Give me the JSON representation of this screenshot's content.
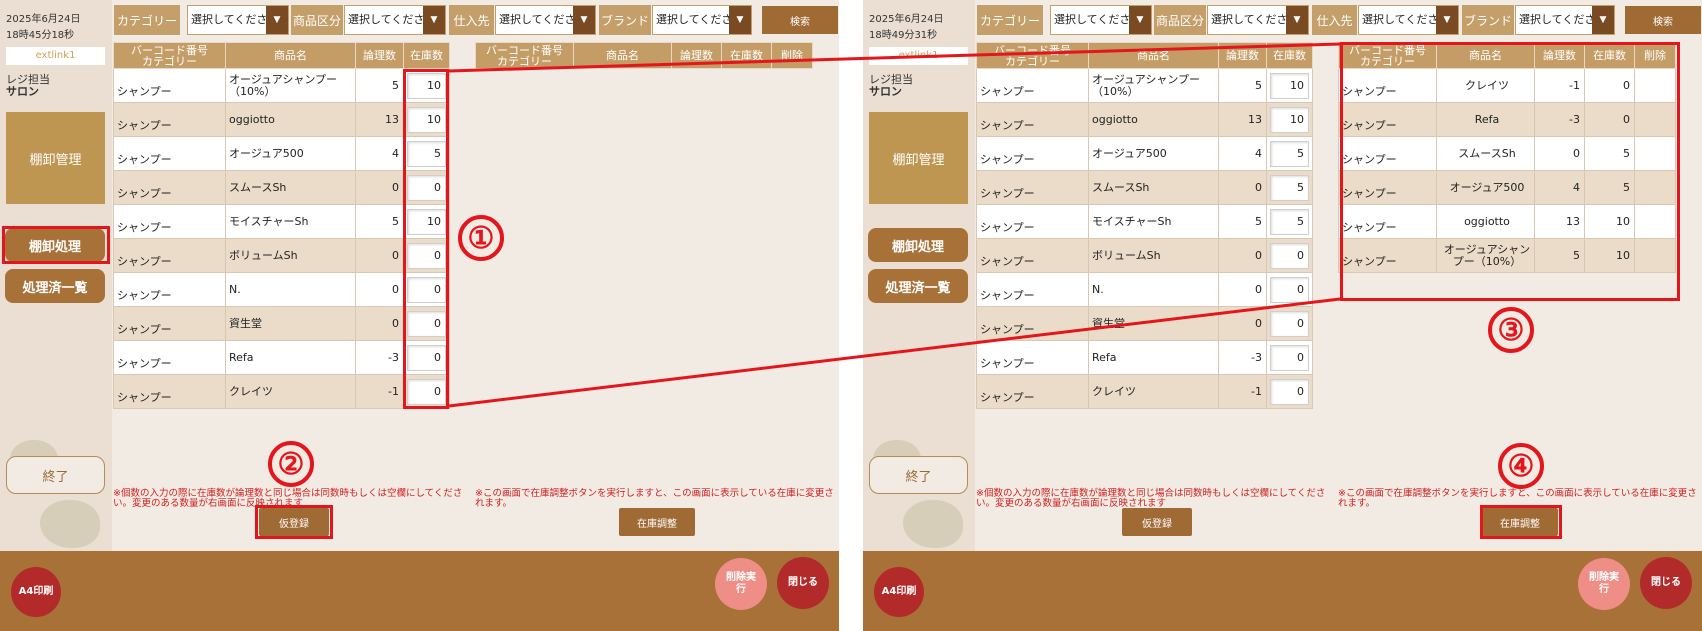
{
  "left": {
    "datetime": {
      "date": "2025年6月24日",
      "time": "18時45分18秒"
    },
    "link": "extlink1",
    "staff_label": "レジ担当",
    "staff_name": "サロン"
  },
  "right": {
    "datetime": {
      "date": "2025年6月24日",
      "time": "18時49分31秒"
    },
    "link": "extlink1",
    "staff_label": "レジ担当",
    "staff_name": "サロン"
  },
  "sidebar": {
    "section_title": "棚卸管理",
    "process_button": "棚卸処理",
    "done_list_button": "処理済一覧",
    "end_button": "終了"
  },
  "filters": {
    "category_label": "カテゴリー",
    "type_label": "商品区分",
    "supplier_label": "仕入先",
    "brand_label": "ブランド",
    "select_placeholder": "選択してください",
    "select_placeholder_short": "選択してくださ",
    "search_button": "検索"
  },
  "main_table": {
    "headers": {
      "barcode_line1": "バーコード番号",
      "barcode_line2": "カテゴリー",
      "name": "商品名",
      "theoretical": "論理数",
      "stock": "在庫数"
    },
    "rows": [
      {
        "category": "シャンプー",
        "name": "オージュアシャンプー（10%）",
        "theoretical": "5",
        "stock_left": "10",
        "stock_right": "10"
      },
      {
        "category": "シャンプー",
        "name": "oggiotto",
        "theoretical": "13",
        "stock_left": "10",
        "stock_right": "10"
      },
      {
        "category": "シャンプー",
        "name": "オージュア500",
        "theoretical": "4",
        "stock_left": "5",
        "stock_right": "5"
      },
      {
        "category": "シャンプー",
        "name": "スムースSh",
        "theoretical": "0",
        "stock_left": "0",
        "stock_right": "5"
      },
      {
        "category": "シャンプー",
        "name": "モイスチャーSh",
        "theoretical": "5",
        "stock_left": "10",
        "stock_right": "5"
      },
      {
        "category": "シャンプー",
        "name": "ボリュームSh",
        "theoretical": "0",
        "stock_left": "0",
        "stock_right": "0"
      },
      {
        "category": "シャンプー",
        "name": "N.",
        "theoretical": "0",
        "stock_left": "0",
        "stock_right": "0"
      },
      {
        "category": "シャンプー",
        "name": "資生堂",
        "theoretical": "0",
        "stock_left": "0",
        "stock_right": "0"
      },
      {
        "category": "シャンプー",
        "name": "Refa",
        "theoretical": "-3",
        "stock_left": "0",
        "stock_right": "0"
      },
      {
        "category": "シャンプー",
        "name": "クレイツ",
        "theoretical": "-1",
        "stock_left": "0",
        "stock_right": "0"
      }
    ]
  },
  "adjust_table": {
    "headers": {
      "barcode_line1": "バーコード番号",
      "barcode_line2": "カテゴリー",
      "name": "商品名",
      "theoretical": "論理数",
      "stock": "在庫数",
      "delete": "削除"
    },
    "rows": [
      {
        "category": "シャンプー",
        "name": "クレイツ",
        "theoretical": "-1",
        "stock": "0"
      },
      {
        "category": "シャンプー",
        "name": "Refa",
        "theoretical": "-3",
        "stock": "0"
      },
      {
        "category": "シャンプー",
        "name": "スムースSh",
        "theoretical": "0",
        "stock": "5"
      },
      {
        "category": "シャンプー",
        "name": "オージュア500",
        "theoretical": "4",
        "stock": "5"
      },
      {
        "category": "シャンプー",
        "name": "oggiotto",
        "theoretical": "13",
        "stock": "10"
      },
      {
        "category": "シャンプー",
        "name": "オージュアシャンプー（10%）",
        "theoretical": "5",
        "stock": "10"
      }
    ]
  },
  "notes": {
    "left": "※個数の入力の際に在庫数が論理数と同じ場合は同数時もしくは空欄にしてください。変更のある数量が右画面に反映されます",
    "right": "※この画面で在庫調整ボタンを実行しますと、この画面に表示している在庫に変更されます。"
  },
  "buttons": {
    "temp_register": "仮登録",
    "stock_adjust": "在庫調整",
    "a4_print": "A4印刷",
    "delete_exec": "削除実行",
    "close": "閉じる"
  },
  "callouts": {
    "one": "①",
    "two": "②",
    "three": "③",
    "four": "④"
  },
  "colors": {
    "accent_brown": "#a77138",
    "header_tan": "#c49d66",
    "highlight_red": "#e4161c",
    "pink_button": "#ef8d87",
    "dark_red_button": "#b32a2a"
  }
}
